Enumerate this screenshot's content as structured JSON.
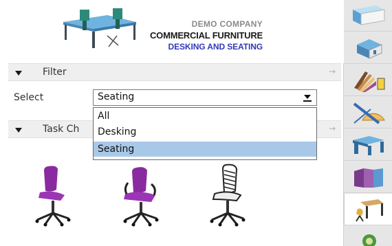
{
  "banner": {
    "company_line1": "DEMO COMPANY",
    "company_line2": "COMMERCIAL FURNITURE",
    "company_line3": "DESKING AND SEATING"
  },
  "filter": {
    "section_label": "Filter",
    "select_label": "Select",
    "selected_value": "Seating",
    "options": [
      "All",
      "Desking",
      "Seating"
    ]
  },
  "task_section": {
    "label": "Task Ch"
  },
  "products": {
    "chair_icons": [
      "purple-office-chair",
      "purple-armchair",
      "white-mesh-chair"
    ]
  },
  "toolbar": {
    "tools": [
      "wall-tool",
      "room-tool",
      "finishes-tool",
      "measure-tool",
      "desking-tool",
      "panels-tool",
      "furniture-tool",
      "more-tool"
    ]
  },
  "colors": {
    "accent_blue": "#2f39b8",
    "selection": "#a8c8e8",
    "chair_purple": "#8a2aa0"
  }
}
